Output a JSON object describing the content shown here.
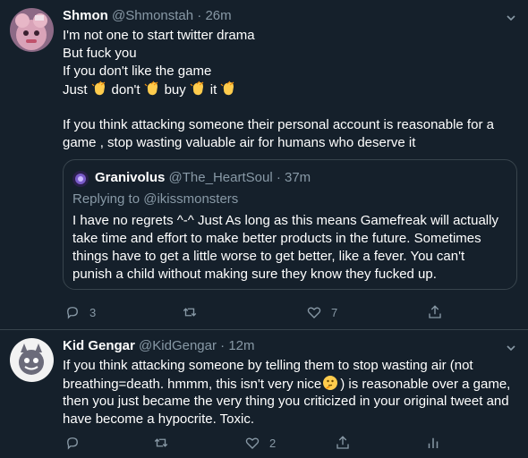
{
  "tweet1": {
    "display_name": "Shmon",
    "handle": "@Shmonstah",
    "separator": "·",
    "time": "26m",
    "lines": [
      "I'm not one to start twitter drama",
      "But fuck you",
      "If you don't like the game"
    ],
    "clap_words": [
      "Just",
      "don't",
      "buy",
      "it"
    ],
    "lines2": [
      "If you think attacking someone their personal account is reasonable for a",
      "game , stop wasting valuable air for humans who deserve it"
    ],
    "quote": {
      "display_name": "Granivolus",
      "handle": "@The_HeartSoul",
      "separator": "·",
      "time": "37m",
      "replying_to_label": "Replying to",
      "replying_to_handle": "@ikissmonsters",
      "lines": [
        "I have no regrets ^-^ Just As long as this means Gamefreak will actually",
        "take time and effort to make better products in the future. Sometimes",
        "things have to get a little worse to get better, like a fever. You can't",
        "punish a child without making sure they know they fucked up."
      ]
    },
    "actions": {
      "reply_count": "3",
      "retweet_count": "",
      "like_count": "7"
    }
  },
  "tweet2": {
    "display_name": "Kid Gengar",
    "handle": "@KidGengar",
    "separator": "·",
    "time": "12m",
    "line1": "If you think attacking someone by telling them to stop wasting air (not",
    "line2_a": "breathing=death. hmmm, this isn't very nice",
    "line2_b": ") is reasonable over a game,",
    "line3": "then you just became the very thing you criticized in your original tweet and",
    "line4": "have become a hypocrite. Toxic.",
    "actions": {
      "reply_count": "",
      "retweet_count": "",
      "like_count": "2"
    }
  },
  "colors": {
    "background": "#15202b",
    "muted_text": "#8899a6",
    "border": "#38444d",
    "text": "#ffffff"
  },
  "icons": {
    "reply": "reply-icon",
    "retweet": "retweet-icon",
    "like": "heart-icon",
    "share": "share-icon",
    "analytics": "analytics-icon",
    "more": "chevron-down-icon",
    "clap": "clapping-hands-emoji",
    "thinking": "thinking-face-emoji"
  }
}
